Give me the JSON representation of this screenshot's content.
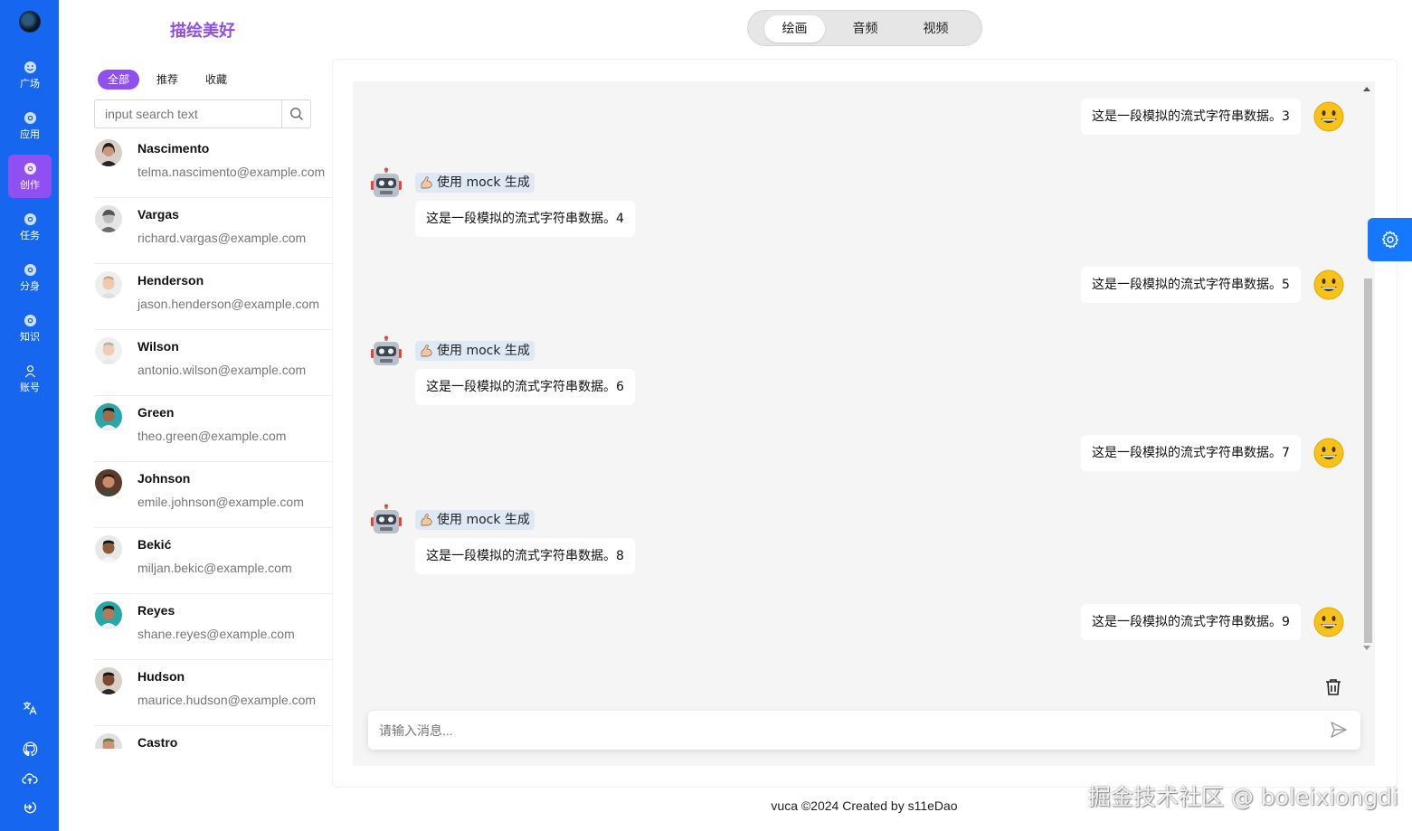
{
  "app": {
    "title": "描绘美好"
  },
  "nav": {
    "items": [
      {
        "label": "广场",
        "icon": "smile-icon"
      },
      {
        "label": "应用",
        "icon": "chrome-icon"
      },
      {
        "label": "创作",
        "icon": "chrome-icon",
        "active": true
      },
      {
        "label": "任务",
        "icon": "chrome-icon"
      },
      {
        "label": "分身",
        "icon": "chrome-icon"
      },
      {
        "label": "知识",
        "icon": "chrome-icon"
      },
      {
        "label": "账号",
        "icon": "user-icon"
      }
    ],
    "bottom_icons": [
      "translate-icon",
      "github-icon",
      "cloud-upload-icon",
      "logout-icon"
    ]
  },
  "header": {
    "tabs": [
      {
        "label": "绘画",
        "active": true
      },
      {
        "label": "音频"
      },
      {
        "label": "视频"
      }
    ]
  },
  "contacts_panel": {
    "filters": [
      {
        "label": "全部",
        "active": true
      },
      {
        "label": "推荐"
      },
      {
        "label": "收藏"
      }
    ],
    "search": {
      "placeholder": "input search text"
    },
    "contacts": [
      {
        "name": "Nascimento",
        "email": "telma.nascimento@example.com"
      },
      {
        "name": "Vargas",
        "email": "richard.vargas@example.com"
      },
      {
        "name": "Henderson",
        "email": "jason.henderson@example.com"
      },
      {
        "name": "Wilson",
        "email": "antonio.wilson@example.com"
      },
      {
        "name": "Green",
        "email": "theo.green@example.com"
      },
      {
        "name": "Johnson",
        "email": "emile.johnson@example.com"
      },
      {
        "name": "Bekić",
        "email": "miljan.bekic@example.com"
      },
      {
        "name": "Reyes",
        "email": "shane.reyes@example.com"
      },
      {
        "name": "Hudson",
        "email": "maurice.hudson@example.com"
      },
      {
        "name": "Castro",
        "email": ""
      }
    ]
  },
  "chat": {
    "messages": [
      {
        "role": "user",
        "text": "这是一段模拟的流式字符串数据。3"
      },
      {
        "role": "bot",
        "tag": "使用 mock 生成",
        "text": "这是一段模拟的流式字符串数据。4"
      },
      {
        "role": "user",
        "text": "这是一段模拟的流式字符串数据。5"
      },
      {
        "role": "bot",
        "tag": "使用 mock 生成",
        "text": "这是一段模拟的流式字符串数据。6"
      },
      {
        "role": "user",
        "text": "这是一段模拟的流式字符串数据。7"
      },
      {
        "role": "bot",
        "tag": "使用 mock 生成",
        "text": "这是一段模拟的流式字符串数据。8"
      },
      {
        "role": "user",
        "text": "这是一段模拟的流式字符串数据。9"
      }
    ],
    "input": {
      "placeholder": "请输入消息..."
    }
  },
  "footer": {
    "text": "vuca ©2024 Created by s11eDao"
  },
  "watermark": "掘金技术社区 @ boleixiongdi",
  "colors": {
    "rail": "#1766f0",
    "accent": "#8f4ff1",
    "brand_text": "#8f4fe0",
    "fab": "#1677ff"
  }
}
